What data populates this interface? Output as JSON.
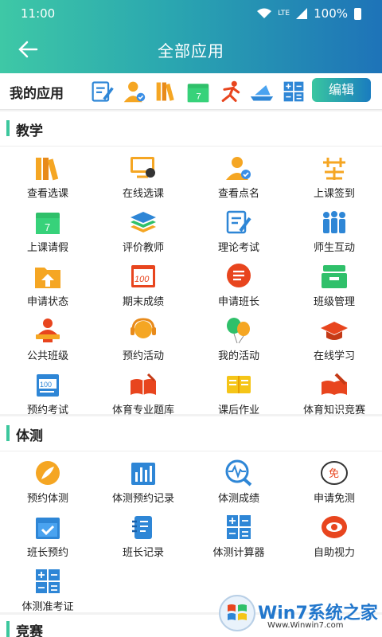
{
  "status": {
    "time": "11:00",
    "network": "LTE",
    "battery": "100%"
  },
  "header": {
    "title": "全部应用",
    "back_icon": "back-arrow-icon"
  },
  "my_apps": {
    "label": "我的应用",
    "icons": [
      "exam-edit-icon",
      "user-check-icon",
      "books-icon",
      "calendar-7-icon",
      "runner-icon",
      "ship-icon",
      "calculator-icon"
    ],
    "edit_label": "编辑"
  },
  "sections": [
    {
      "title": "教学",
      "items": [
        {
          "label": "查看选课",
          "icon": "books-icon"
        },
        {
          "label": "在线选课",
          "icon": "screen-icon"
        },
        {
          "label": "查看点名",
          "icon": "user-check-icon"
        },
        {
          "label": "上课签到",
          "icon": "sign-icon"
        },
        {
          "label": "上课请假",
          "icon": "calendar-7-icon"
        },
        {
          "label": "评价教师",
          "icon": "layers-icon"
        },
        {
          "label": "理论考试",
          "icon": "exam-edit-icon"
        },
        {
          "label": "师生互动",
          "icon": "group-icon"
        },
        {
          "label": "申请状态",
          "icon": "upload-folder-icon"
        },
        {
          "label": "期末成绩",
          "icon": "score-100-icon"
        },
        {
          "label": "申请班长",
          "icon": "message-icon"
        },
        {
          "label": "班级管理",
          "icon": "drawer-icon"
        },
        {
          "label": "公共班级",
          "icon": "lecturer-icon"
        },
        {
          "label": "预约活动",
          "icon": "headset-icon"
        },
        {
          "label": "我的活动",
          "icon": "balloons-icon"
        },
        {
          "label": "在线学习",
          "icon": "graduation-cap-icon"
        },
        {
          "label": "预约考试",
          "icon": "test-100-icon"
        },
        {
          "label": "体育专业题库",
          "icon": "open-book-icon"
        },
        {
          "label": "课后作业",
          "icon": "notebook-icon"
        },
        {
          "label": "体育知识竞赛",
          "icon": "book-pen-icon"
        }
      ]
    },
    {
      "title": "体测",
      "items": [
        {
          "label": "预约体测",
          "icon": "feather-circle-icon"
        },
        {
          "label": "体测预约记录",
          "icon": "bar-chart-icon"
        },
        {
          "label": "体测成绩",
          "icon": "pulse-search-icon"
        },
        {
          "label": "申请免测",
          "icon": "exempt-icon"
        },
        {
          "label": "班长预约",
          "icon": "calendar-check-icon"
        },
        {
          "label": "班长记录",
          "icon": "notepad-icon"
        },
        {
          "label": "体测计算器",
          "icon": "calculator-icon"
        },
        {
          "label": "自助视力",
          "icon": "eye-icon"
        },
        {
          "label": "体测准考证",
          "icon": "calculator-icon"
        }
      ]
    },
    {
      "title": "竞赛",
      "items": []
    }
  ],
  "watermark": {
    "text": "Win7系统之家",
    "url": "Www.Winwin7.com",
    "icon": "windows-logo-icon"
  }
}
